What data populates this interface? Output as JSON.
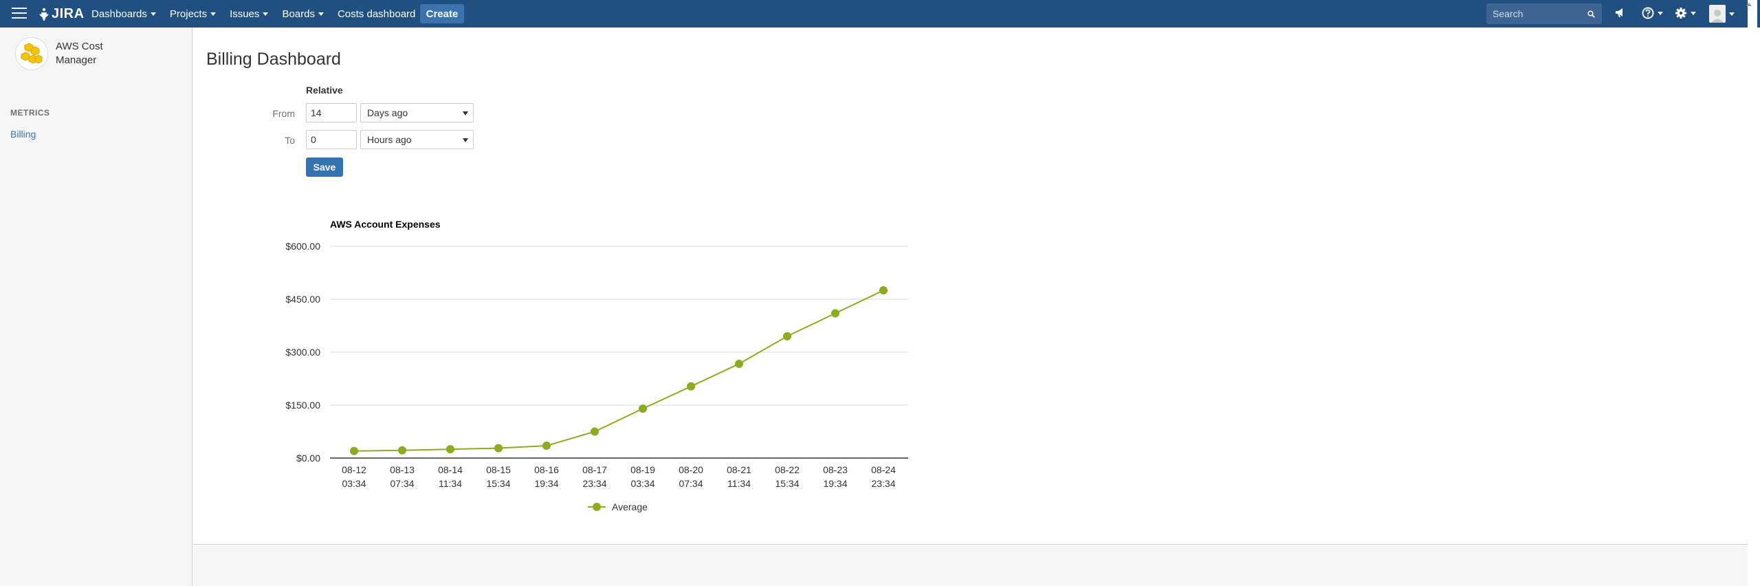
{
  "topnav": {
    "logo_text": "JIRA",
    "links": [
      {
        "label": "Dashboards",
        "caret": true
      },
      {
        "label": "Projects",
        "caret": true
      },
      {
        "label": "Issues",
        "caret": true
      },
      {
        "label": "Boards",
        "caret": true
      },
      {
        "label": "Costs dashboard",
        "caret": false
      }
    ],
    "create_label": "Create",
    "search_placeholder": "Search",
    "bg_color": "#205081"
  },
  "sidebar": {
    "project_name": "AWS Cost Manager",
    "section_label": "METRICS",
    "items": [
      {
        "label": "Billing"
      }
    ]
  },
  "main": {
    "title": "Billing Dashboard",
    "form": {
      "mode_label": "Relative",
      "from_label": "From",
      "from_value": "14",
      "from_unit": "Days ago",
      "to_label": "To",
      "to_value": "0",
      "to_unit": "Hours ago",
      "save_label": "Save"
    }
  },
  "chart_data": {
    "type": "line",
    "title": "AWS Account Expenses",
    "xlabel": "",
    "ylabel": "",
    "categories": [
      [
        "08-12",
        "03:34"
      ],
      [
        "08-13",
        "07:34"
      ],
      [
        "08-14",
        "11:34"
      ],
      [
        "08-15",
        "15:34"
      ],
      [
        "08-16",
        "19:34"
      ],
      [
        "08-17",
        "23:34"
      ],
      [
        "08-19",
        "03:34"
      ],
      [
        "08-20",
        "07:34"
      ],
      [
        "08-21",
        "11:34"
      ],
      [
        "08-22",
        "15:34"
      ],
      [
        "08-23",
        "19:34"
      ],
      [
        "08-24",
        "23:34"
      ]
    ],
    "series": [
      {
        "name": "Average",
        "color": "#8aac1e",
        "values": [
          20,
          22,
          25,
          28,
          35,
          75,
          140,
          203,
          267,
          345,
          410,
          475
        ]
      }
    ],
    "yticks": [
      "$600.00",
      "$450.00",
      "$300.00",
      "$150.00",
      "$0.00"
    ],
    "ylim": [
      0,
      600
    ],
    "grid": true,
    "legend": "bottom"
  }
}
